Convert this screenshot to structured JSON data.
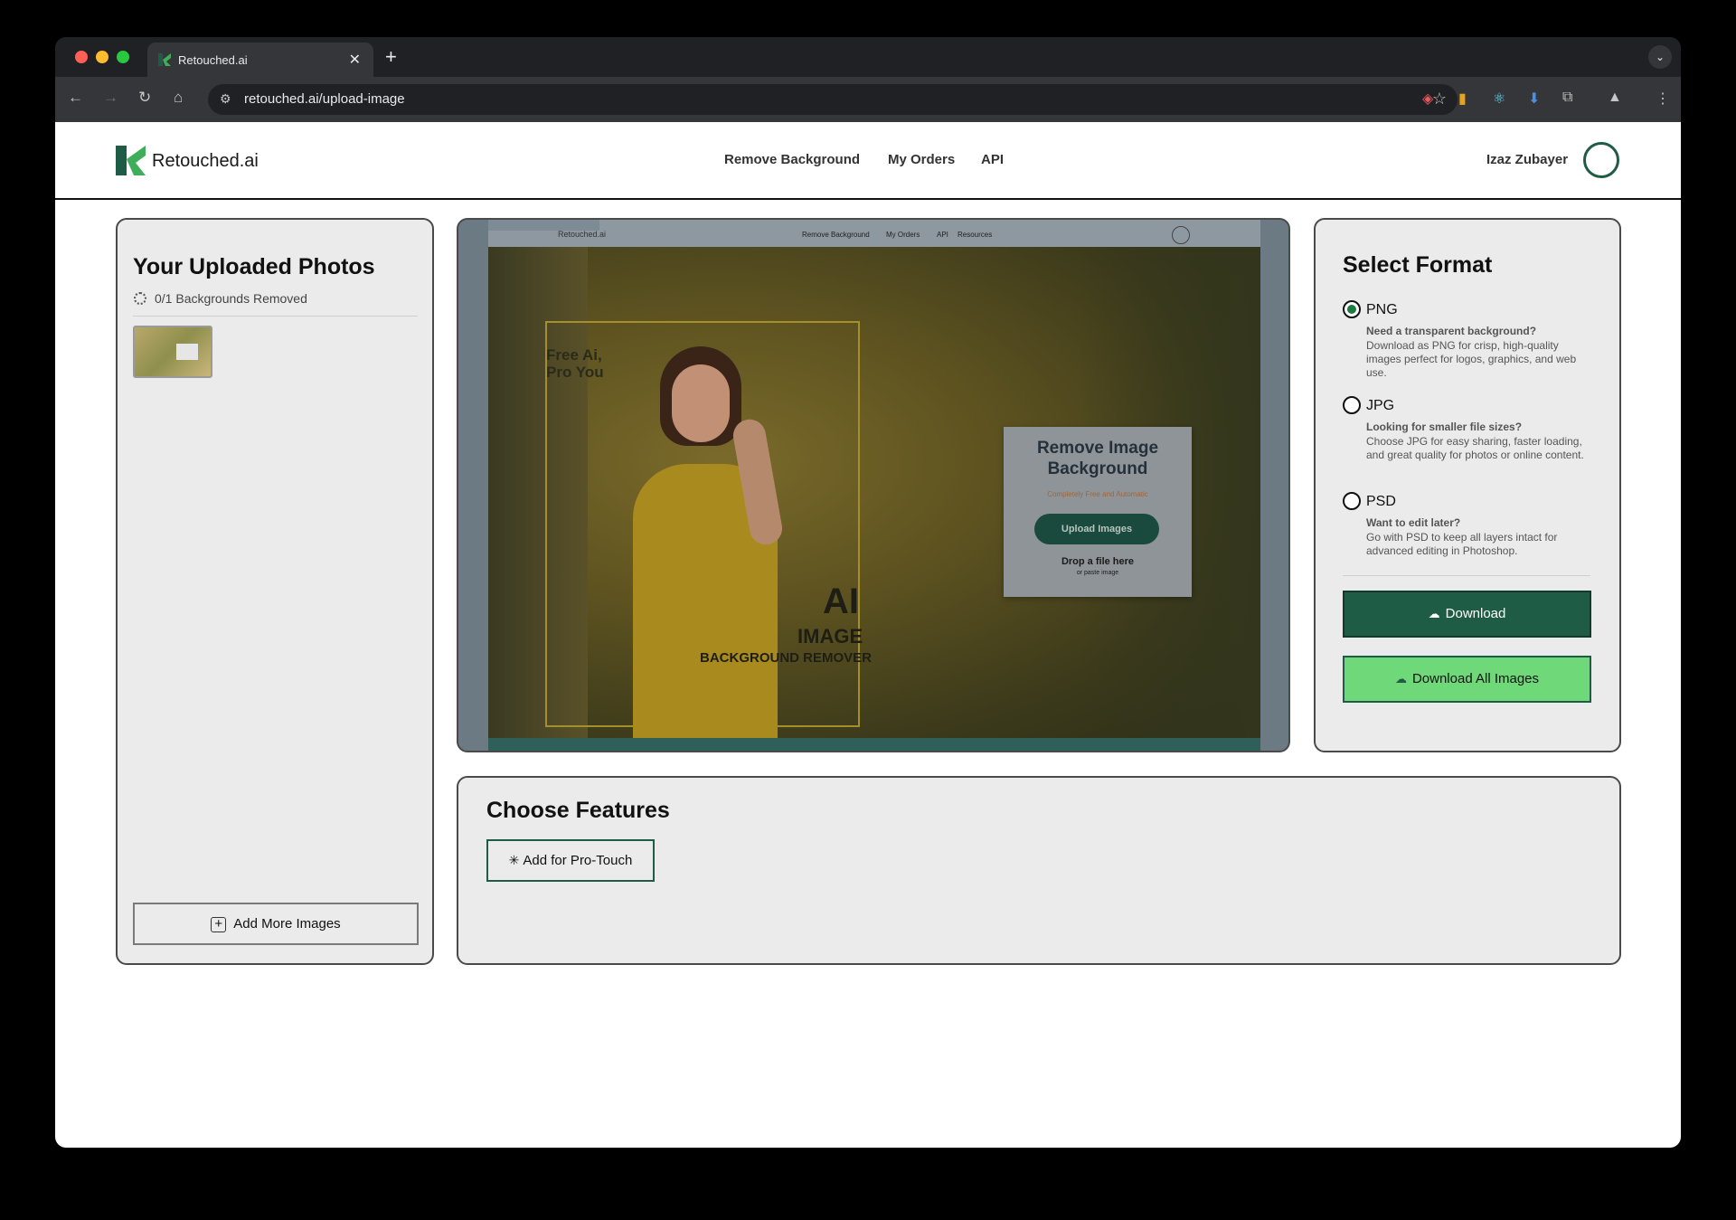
{
  "browser": {
    "tab_title": "Retouched.ai",
    "new_tab": "+",
    "address": "retouched.ai/upload-image"
  },
  "header": {
    "brand": "Retouched.ai",
    "nav": [
      "Remove Background",
      "My Orders",
      "API"
    ],
    "user_name": "Izaz Zubayer"
  },
  "uploaded": {
    "title": "Your Uploaded Photos",
    "status": "0/1 Backgrounds Removed",
    "add_more": "Add More Images"
  },
  "preview": {
    "nav": [
      "Remove Background",
      "My Orders",
      "API",
      "Resources"
    ],
    "brand": "Retouched.ai",
    "tagline_1": "Free Ai,",
    "tagline_2": "Pro You",
    "big_1": "AI",
    "big_2": "IMAGE",
    "big_3": "BACKGROUND REMOVER",
    "card_title": "Remove Image Background",
    "card_sub": "Completely Free and Automatic",
    "card_btn": "Upload Images",
    "card_drop": "Drop a file here",
    "card_paste": "or paste image"
  },
  "format": {
    "title": "Select Format",
    "options": [
      {
        "label": "PNG",
        "question": "Need a transparent background?",
        "desc": "Download as PNG for crisp, high-quality images perfect for logos, graphics, and web use."
      },
      {
        "label": "JPG",
        "question": "Looking for smaller file sizes?",
        "desc": "Choose JPG for easy sharing, faster loading, and great quality for photos or online content."
      },
      {
        "label": "PSD",
        "question": "Want to edit later?",
        "desc": "Go with PSD to keep all layers intact for advanced editing in Photoshop."
      }
    ],
    "selected": "PNG",
    "download": "Download",
    "download_all": "Download All Images"
  },
  "features": {
    "title": "Choose Features",
    "pro_touch": "Add for Pro-Touch"
  },
  "colors": {
    "brand_dark": "#1f5c45",
    "brand_light": "#6fd97a",
    "panel_bg": "#ebebeb"
  }
}
